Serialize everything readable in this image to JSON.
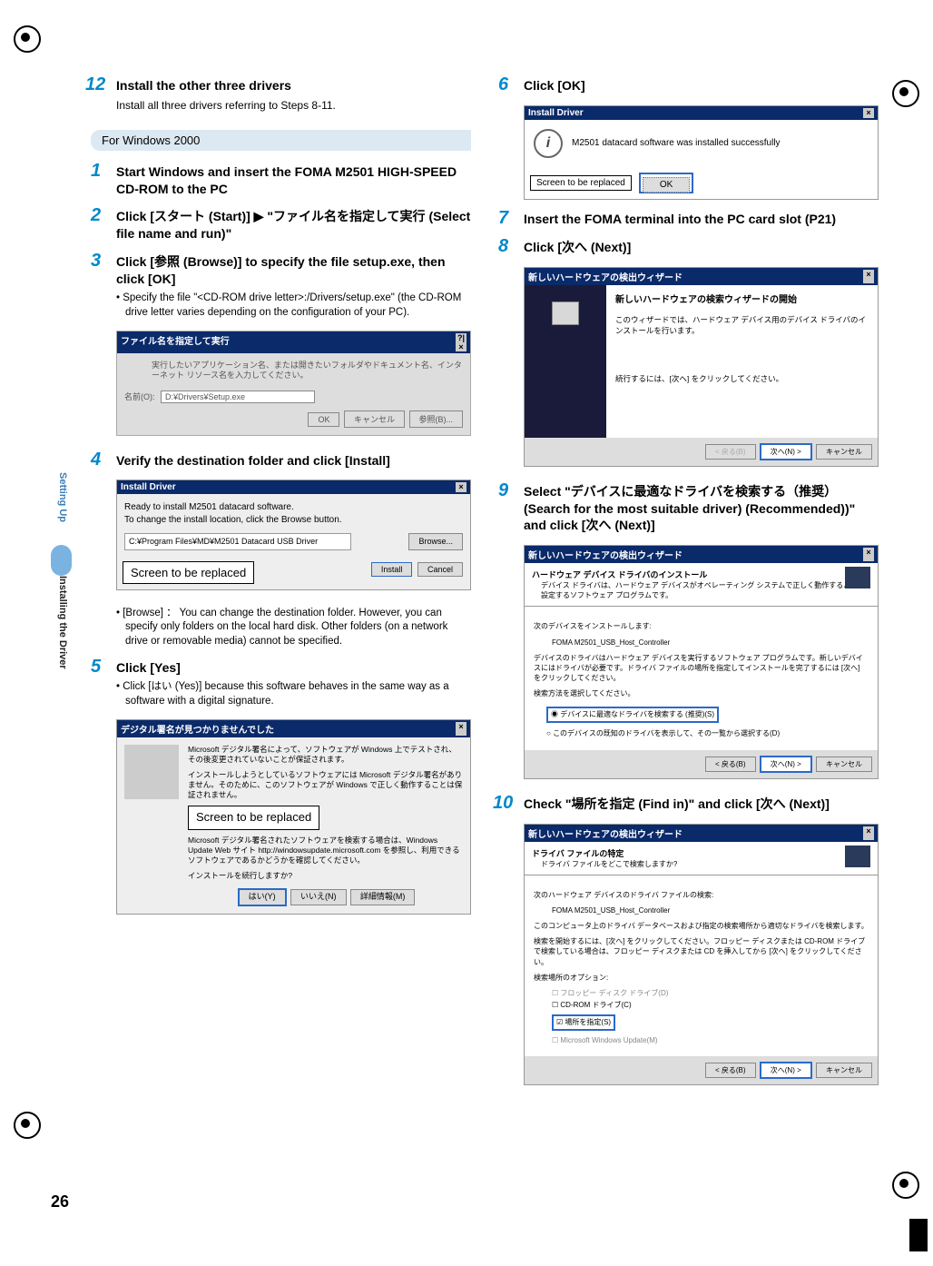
{
  "page_number": "26",
  "side_label_1": "Setting Up",
  "side_label_2": "Installing the Driver",
  "left": {
    "step12": {
      "num": "12",
      "title": "Install the other three drivers",
      "body": "Install all three drivers referring to Steps 8-11."
    },
    "section_header": "For Windows 2000",
    "step1": {
      "num": "1",
      "title": "Start Windows and insert the FOMA M2501 HIGH-SPEED CD-ROM to the PC"
    },
    "step2": {
      "num": "2",
      "title": "Click [スタート (Start)] ▶ \"ファイル名を指定して実行 (Select file name and run)\""
    },
    "step3": {
      "num": "3",
      "title": "Click [参照 (Browse)] to specify the file setup.exe, then click [OK]",
      "bullet": "• Specify the file \"<CD-ROM drive letter>:/Drivers/setup.exe\" (the CD-ROM drive letter varies depending on the configuration of your PC).",
      "dlg_title": "ファイル名を指定して実行",
      "dlg_text": "実行したいアプリケーション名、または開きたいフォルダやドキュメント名、インターネット リソース名を入力してください。",
      "dlg_label": "名前(O):",
      "dlg_value": "D:¥Drivers¥Setup.exe",
      "dlg_ok": "OK",
      "dlg_cancel": "キャンセル",
      "dlg_browse": "参照(B)..."
    },
    "step4": {
      "num": "4",
      "title": "Verify the destination folder and click [Install]",
      "dlg_title": "Install Driver",
      "dlg_line1": "Ready to install M2501 datacard software.",
      "dlg_line2": "To change the install location, click the Browse button.",
      "dlg_path": "C:¥Program Files¥MD¥M2501 Datacard USB Driver",
      "dlg_browse": "Browse...",
      "dlg_install": "Install",
      "dlg_cancel": "Cancel",
      "callout": "Screen to be replaced",
      "bullet": "• [Browse] ： You can change the destination folder. However, you can specify only folders on the local hard disk. Other folders (on a network drive or removable media) cannot be specified."
    },
    "step5": {
      "num": "5",
      "title": "Click [Yes]",
      "bullet": "• Click [はい (Yes)] because this software behaves in the same way as a software with a digital signature.",
      "dlg_title": "デジタル署名が見つかりませんでした",
      "para1": "Microsoft デジタル署名によって、ソフトウェアが Windows 上でテストされ、その後変更されていないことが保証されます。",
      "para2": "インストールしようとしているソフトウェアには Microsoft デジタル署名がありません。そのために、このソフトウェアが Windows で正しく動作することは保証されません。",
      "callout": "Screen to be replaced",
      "para3": "Microsoft デジタル署名されたソフトウェアを検索する場合は、Windows Update Web サイト http://windowsupdate.microsoft.com を参照し、利用できるソフトウェアであるかどうかを確認してください。",
      "para4": "インストールを続行しますか?",
      "btn_yes": "はい(Y)",
      "btn_no": "いいえ(N)",
      "btn_more": "詳細情報(M)"
    }
  },
  "right": {
    "step6": {
      "num": "6",
      "title": "Click [OK]",
      "dlg_title": "Install Driver",
      "dlg_msg": "M2501 datacard software was installed successfully",
      "callout": "Screen to be replaced",
      "ok": "OK"
    },
    "step7": {
      "num": "7",
      "title": "Insert the FOMA terminal into the PC card slot (P21)"
    },
    "step8": {
      "num": "8",
      "title": "Click [次へ (Next)]",
      "dlg_title": "新しいハードウェアの検出ウィザード",
      "wiz_title": "新しいハードウェアの検索ウィザードの開始",
      "wiz_body": "このウィザードでは、ハードウェア デバイス用のデバイス ドライバのインストールを行います。",
      "wiz_cont": "続行するには、[次へ] をクリックしてください。",
      "btn_back": "< 戻る(B)",
      "btn_next": "次へ(N) >",
      "btn_cancel": "キャンセル"
    },
    "step9": {
      "num": "9",
      "title": "Select \"デバイスに最適なドライバを検索する（推奨）(Search for the most suitable driver) (Recommended))\" and click [次へ (Next)]",
      "dlg_title": "新しいハードウェアの検出ウィザード",
      "hdr_title": "ハードウェア デバイス ドライバのインストール",
      "hdr_sub": "デバイス ドライバは、ハードウェア デバイスがオペレーティング システムで正しく動作するように設定するソフトウェア プログラムです。",
      "body1": "次のデバイスをインストールします:",
      "device": "FOMA M2501_USB_Host_Controller",
      "body2": "デバイスのドライバはハードウェア デバイスを実行するソフトウェア プログラムです。新しいデバイスにはドライバが必要です。ドライバ ファイルの場所を指定してインストールを完了するには [次へ] をクリックしてください。",
      "body3": "検索方法を選択してください。",
      "opt1": "デバイスに最適なドライバを検索する (推奨)(S)",
      "opt2": "このデバイスの既知のドライバを表示して、その一覧から選択する(D)",
      "btn_back": "< 戻る(B)",
      "btn_next": "次へ(N) >",
      "btn_cancel": "キャンセル"
    },
    "step10": {
      "num": "10",
      "title": "Check \"場所を指定 (Find in)\" and click [次へ (Next)]",
      "dlg_title": "新しいハードウェアの検出ウィザード",
      "hdr_title": "ドライバ ファイルの特定",
      "hdr_sub": "ドライバ ファイルをどこで検索しますか?",
      "body1": "次のハードウェア デバイスのドライバ ファイルの検索:",
      "device": "FOMA M2501_USB_Host_Controller",
      "body2": "このコンピュータ上のドライバ データベースおよび指定の検索場所から適切なドライバを検索します。",
      "body3": "検索を開始するには、[次へ] をクリックしてください。フロッピー ディスクまたは CD-ROM ドライブで検索している場合は、フロッピー ディスクまたは CD を挿入してから [次へ] をクリックしてください。",
      "body4": "検索場所のオプション:",
      "chk1": "フロッピー ディスク ドライブ(D)",
      "chk2": "CD-ROM ドライブ(C)",
      "chk3": "場所を指定(S)",
      "chk4": "Microsoft Windows Update(M)",
      "btn_back": "< 戻る(B)",
      "btn_next": "次へ(N) >",
      "btn_cancel": "キャンセル"
    }
  }
}
